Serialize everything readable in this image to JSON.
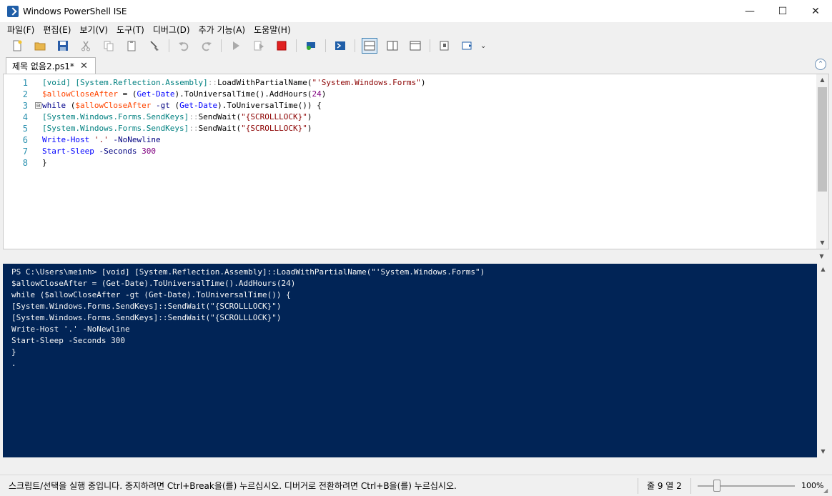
{
  "window": {
    "title": "Windows PowerShell ISE",
    "minimize": "—",
    "maximize": "☐",
    "close": "✕"
  },
  "menu": [
    "파일(F)",
    "편집(E)",
    "보기(V)",
    "도구(T)",
    "디버그(D)",
    "추가 기능(A)",
    "도움말(H)"
  ],
  "toolbar": {
    "overflow": "⌄",
    "items": [
      "new-script",
      "open",
      "save",
      "cut",
      "copy",
      "paste",
      "clear-console",
      "undo",
      "redo",
      "run-script",
      "run-selection",
      "stop",
      "new-remote-tab",
      "start-powershell",
      "layout-top",
      "layout-right",
      "layout-max",
      "show-command-window",
      "show-command-addon"
    ]
  },
  "tab": {
    "label": "제목 없음2.ps1*",
    "close": "✕",
    "collapse": "⌃"
  },
  "editor": {
    "line_numbers": [
      "1",
      "2",
      "3",
      "4",
      "5",
      "6",
      "7",
      "8"
    ],
    "fold_marker": "⊟",
    "lines": [
      "[void] [System.Reflection.Assembly]::LoadWithPartialName(\"'System.Windows.Forms\")",
      "$allowCloseAfter = (Get-Date).ToUniversalTime().AddHours(24)",
      "while ($allowCloseAfter -gt (Get-Date).ToUniversalTime()) {",
      "[System.Windows.Forms.SendKeys]::SendWait(\"{SCROLLLOCK}\")",
      "[System.Windows.Forms.SendKeys]::SendWait(\"{SCROLLLOCK}\")",
      "Write-Host '.' -NoNewline",
      "Start-Sleep -Seconds 300",
      "}"
    ]
  },
  "console": {
    "lines": [
      "PS C:\\Users\\meinh> [void] [System.Reflection.Assembly]::LoadWithPartialName(\"'System.Windows.Forms\")",
      "$allowCloseAfter = (Get-Date).ToUniversalTime().AddHours(24)",
      "while ($allowCloseAfter -gt (Get-Date).ToUniversalTime()) {",
      "[System.Windows.Forms.SendKeys]::SendWait(\"{SCROLLLOCK}\")",
      "[System.Windows.Forms.SendKeys]::SendWait(\"{SCROLLLOCK}\")",
      "Write-Host '.' -NoNewline",
      "Start-Sleep -Seconds 300",
      "}",
      "."
    ]
  },
  "status": {
    "message": "스크립트/선택을 실행 중입니다. 중지하려면 Ctrl+Break을(를) 누르십시오. 디버거로 전환하려면 Ctrl+B을(를) 누르십시오.",
    "position": "줄 9  열 2",
    "zoom": "100%",
    "zoom_fraction": 0.2
  },
  "colors": {
    "console_bg": "#012456",
    "accent": "#1f5ea8"
  }
}
